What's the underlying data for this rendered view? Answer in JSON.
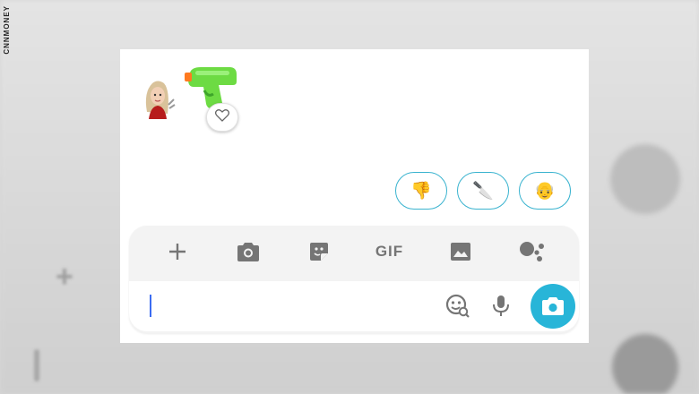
{
  "watermark": "CNNMONEY",
  "chat": {
    "avatar": "bitmoji-avatar",
    "sticker": "water-gun-emoji",
    "reaction": "heart-icon"
  },
  "suggestions": [
    {
      "emoji": "👎",
      "name": "thumbs-down"
    },
    {
      "emoji": "🔪",
      "name": "knife"
    },
    {
      "emoji": "👴",
      "name": "old-man"
    }
  ],
  "toolbar": {
    "items": [
      "plus-icon",
      "camera-icon",
      "sticker-icon",
      "gif-button",
      "image-icon",
      "assistant-icon"
    ],
    "gif_label": "GIF"
  },
  "compose": {
    "input_value": "",
    "icons": [
      "sticker-search-icon",
      "microphone-icon",
      "camera-button"
    ]
  },
  "colors": {
    "accent": "#28b5d8",
    "chip_border": "#39b3cf",
    "panel": "#f3f3f3",
    "icon": "#757575",
    "cursor": "#3b6cf2"
  }
}
